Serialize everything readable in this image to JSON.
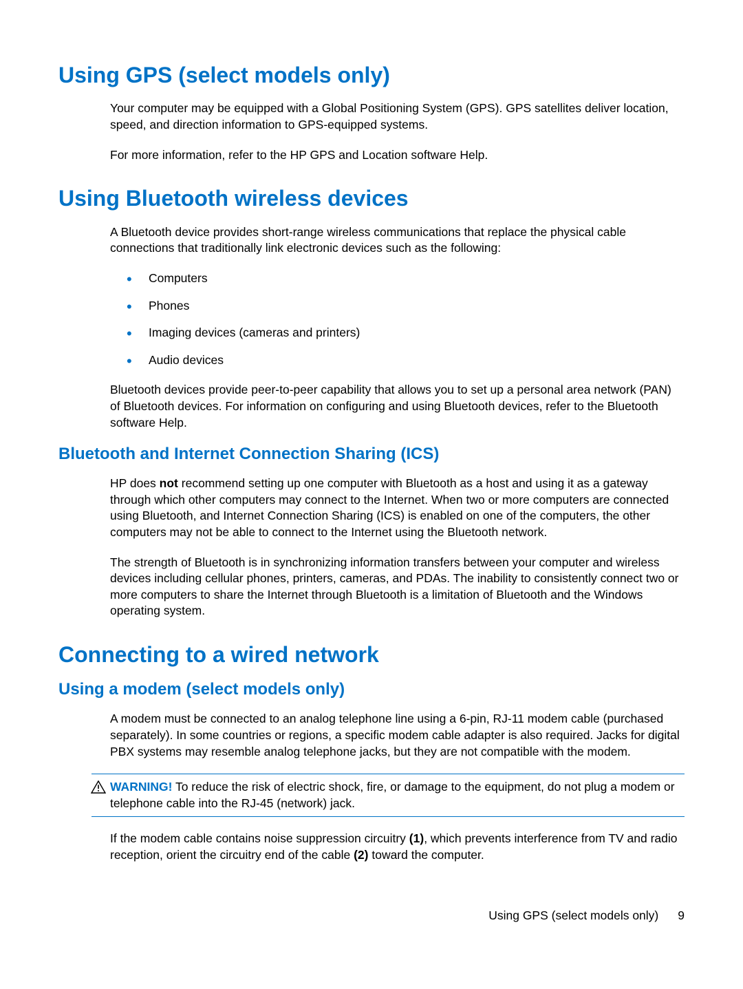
{
  "sections": {
    "gps": {
      "title": "Using GPS (select models only)",
      "p1": "Your computer may be equipped with a Global Positioning System (GPS). GPS satellites deliver location, speed, and direction information to GPS-equipped systems.",
      "p2": "For more information, refer to the HP GPS and Location software Help."
    },
    "bluetooth": {
      "title": "Using Bluetooth wireless devices",
      "p1": "A Bluetooth device provides short-range wireless communications that replace the physical cable connections that traditionally link electronic devices such as the following:",
      "list": [
        "Computers",
        "Phones",
        "Imaging devices (cameras and printers)",
        "Audio devices"
      ],
      "p2": "Bluetooth devices provide peer-to-peer capability that allows you to set up a personal area network (PAN) of Bluetooth devices. For information on configuring and using Bluetooth devices, refer to the Bluetooth software Help.",
      "ics": {
        "title": "Bluetooth and Internet Connection Sharing (ICS)",
        "p1_prefix": "HP does ",
        "p1_bold": "not",
        "p1_suffix": " recommend setting up one computer with Bluetooth as a host and using it as a gateway through which other computers may connect to the Internet. When two or more computers are connected using Bluetooth, and Internet Connection Sharing (ICS) is enabled on one of the computers, the other computers may not be able to connect to the Internet using the Bluetooth network.",
        "p2": "The strength of Bluetooth is in synchronizing information transfers between your computer and wireless devices including cellular phones, printers, cameras, and PDAs. The inability to consistently connect two or more computers to share the Internet through Bluetooth is a limitation of Bluetooth and the Windows operating system."
      }
    },
    "wired": {
      "title": "Connecting to a wired network",
      "modem": {
        "title": "Using a modem (select models only)",
        "p1": "A modem must be connected to an analog telephone line using a 6-pin, RJ-11 modem cable (purchased separately). In some countries or regions, a specific modem cable adapter is also required. Jacks for digital PBX systems may resemble analog telephone jacks, but they are not compatible with the modem.",
        "warning_label": "WARNING!",
        "warning_text": "   To reduce the risk of electric shock, fire, or damage to the equipment, do not plug a modem or telephone cable into the RJ-45 (network) jack.",
        "p2_a": "If the modem cable contains noise suppression circuitry ",
        "p2_b1": "(1)",
        "p2_c": ", which prevents interference from TV and radio reception, orient the circuitry end of the cable ",
        "p2_b2": "(2)",
        "p2_d": " toward the computer."
      }
    }
  },
  "footer": {
    "text": "Using GPS (select models only)",
    "page": "9"
  }
}
